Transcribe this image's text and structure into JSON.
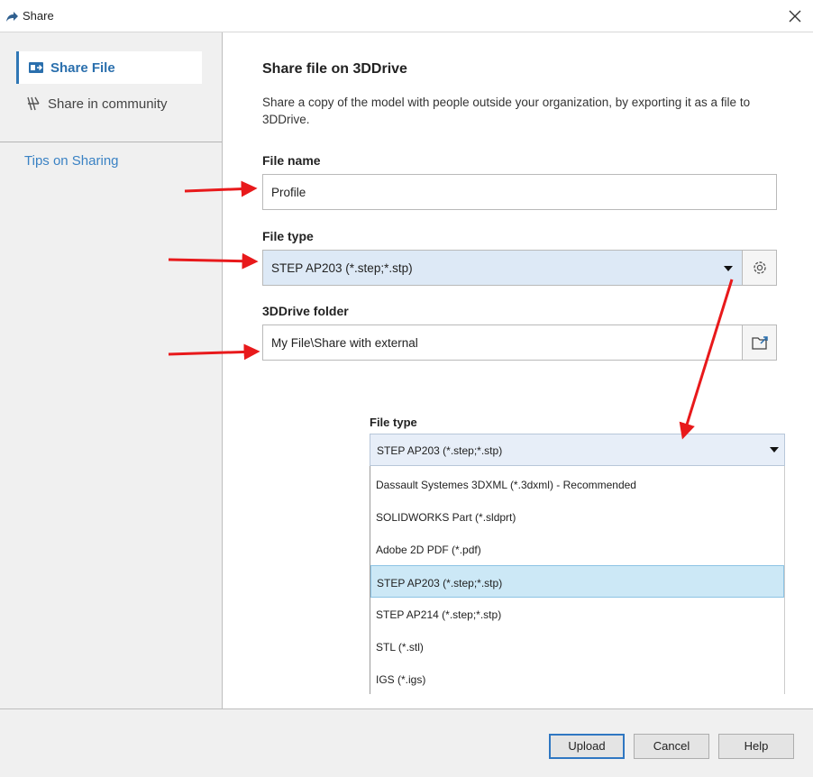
{
  "window": {
    "title": "Share"
  },
  "sidebar": {
    "items": [
      {
        "label": "Share File",
        "active": true
      },
      {
        "label": "Share in community",
        "active": false
      }
    ],
    "tips_link": "Tips on Sharing"
  },
  "main": {
    "heading": "Share file on 3DDrive",
    "description": "Share a copy of the model with people outside your organization, by exporting it as a file to 3DDrive.",
    "file_name": {
      "label": "File name",
      "value": "Profile"
    },
    "file_type": {
      "label": "File type",
      "value": "STEP AP203 (*.step;*.stp)"
    },
    "folder": {
      "label": "3DDrive folder",
      "value": "My File\\Share with external"
    }
  },
  "dropdown": {
    "label": "File type",
    "selected": "STEP AP203 (*.step;*.stp)",
    "options": [
      "Dassault Systemes 3DXML (*.3dxml) - Recommended",
      "SOLIDWORKS Part (*.sldprt)",
      "Adobe 2D PDF (*.pdf)",
      "STEP AP203 (*.step;*.stp)",
      "STEP AP214 (*.step;*.stp)",
      "STL (*.stl)",
      "IGS (*.igs)"
    ],
    "selected_index": 3
  },
  "footer": {
    "upload": "Upload",
    "cancel": "Cancel",
    "help": "Help"
  },
  "colors": {
    "accent": "#2a6fad",
    "link": "#3a82c4",
    "selection": "#cce8f6",
    "annotation": "#e8191b"
  }
}
